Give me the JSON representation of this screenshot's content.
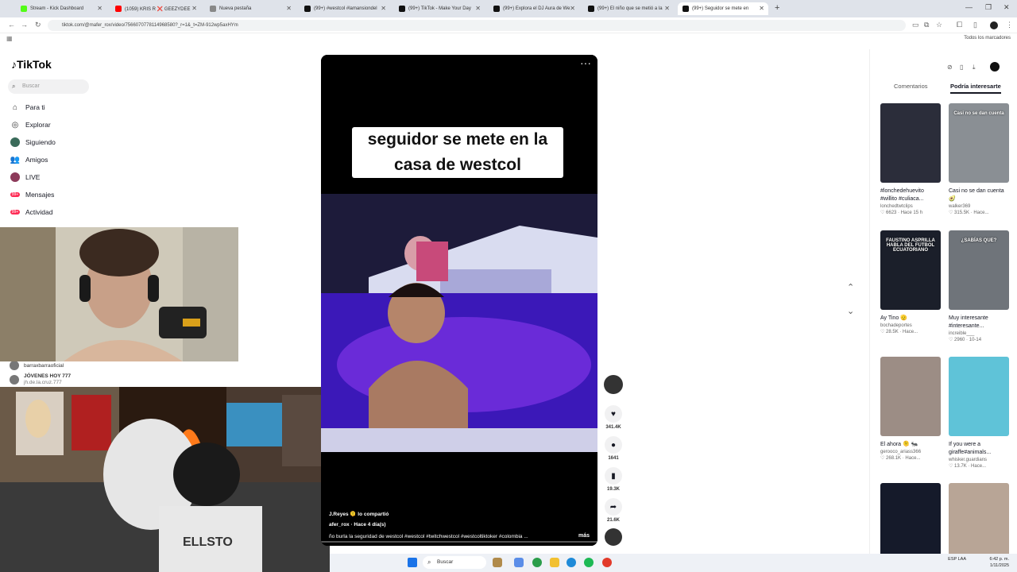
{
  "browser": {
    "tabs": [
      {
        "label": "Stream - Kick Dashboard",
        "color": "#53fc18"
      },
      {
        "label": "(1059) KRIS R ❌ GEEZYDEE",
        "color": "#ff0000"
      },
      {
        "label": "Nueva pestaña",
        "color": "#888888"
      },
      {
        "label": "(99+) #westcol #lamansiondel",
        "color": "#111111"
      },
      {
        "label": "(99+) TikTok - Make Your Day",
        "color": "#111111"
      },
      {
        "label": "(99+) Explora el DJ Aura de We",
        "color": "#111111"
      },
      {
        "label": "(99+) El niño que se metió a la",
        "color": "#111111"
      },
      {
        "label": "(99+) Seguidor se mete en",
        "color": "#111111"
      }
    ],
    "url": "tiktok.com/@mafer_rox/video/7566070778114968580?_r=1&_t=ZM-912wp5axHYm",
    "bookmarks_label": "Todos los marcadores"
  },
  "sidebar": {
    "logo": "TikTok",
    "search_placeholder": "Buscar",
    "items": [
      {
        "label": "Para ti",
        "icon": "home-icon"
      },
      {
        "label": "Explorar",
        "icon": "compass-icon"
      },
      {
        "label": "Siguiendo",
        "icon": "following-icon"
      },
      {
        "label": "Amigos",
        "icon": "friends-icon"
      },
      {
        "label": "LIVE",
        "icon": "live-icon"
      },
      {
        "label": "Mensajes",
        "icon": "messages-icon",
        "badge": "99+"
      },
      {
        "label": "Actividad",
        "icon": "activity-icon",
        "badge": "99+"
      }
    ],
    "accounts": [
      {
        "name": "barraxbarraoficial"
      },
      {
        "name": "JÓVENES HOY 777",
        "sub": "jh.de.la.cruz.777"
      }
    ]
  },
  "video": {
    "caption": "seguidor se mete en la casa de westcol",
    "shared_by": "J.Reyes 🫠 lo compartió",
    "author_line": "afer_rox · Hace 4 día(s)",
    "description": "ño burla la seguridad de westcol  #westcol  #twitchwestcol  #westcoltiktoker  #colombia  ...",
    "more": "más",
    "likes": "341.4K",
    "comments": "1641",
    "saves": "19.3K",
    "shares": "21.6K"
  },
  "right_panel": {
    "tabs": [
      "Comentarios",
      "Podría interesarte"
    ],
    "active_tab": "Podría interesarte",
    "cards": [
      {
        "title": "#lonchedehuevito #willito #culiaca...",
        "user": "lonchedtwtclips",
        "meta": "♡ 6623 · Hace 15 h",
        "thumb_text": "",
        "bg": "#2b2d3a"
      },
      {
        "title": "Casi no se dan cuenta 🥑",
        "user": "walker369",
        "meta": "♡ 315.5K · Hace...",
        "thumb_text": "Casi no se dan cuenta",
        "bg": "#8a8f94"
      },
      {
        "title": "Ay Tino 🫡",
        "user": "bochadeportes",
        "meta": "♡ 28.5K · Hace...",
        "thumb_text": "FAUSTINO ASPRILLA HABLA DEL FÚTBOL ECUATORIANO",
        "bg": "#1b1f2a"
      },
      {
        "title": "Muy interesante #interesante...",
        "user": "increible___",
        "meta": "♡ 2960 · 10-14",
        "thumb_text": "¿SABÍAS QUE?",
        "bg": "#6f747a"
      },
      {
        "title": "El ahora 🫠 🐜",
        "user": "gerooco_ariass366",
        "meta": "♡ 268.1K · Hace...",
        "thumb_text": "",
        "bg": "#9c8d85"
      },
      {
        "title": "If you were a giraffe#animals...",
        "user": "whisker.guardians",
        "meta": "♡ 13.7K · Hace...",
        "thumb_text": "",
        "bg": "#5fc3d8"
      },
      {
        "title": "",
        "user": "",
        "meta": "",
        "thumb_text": "",
        "bg": "#151a2a"
      },
      {
        "title": "",
        "user": "",
        "meta": "",
        "thumb_text": "",
        "bg": "#b8a596"
      }
    ]
  },
  "taskbar": {
    "search": "Buscar",
    "lang": "ESP LAA",
    "time": "6:42 p. m.",
    "date": "1/11/2025"
  }
}
